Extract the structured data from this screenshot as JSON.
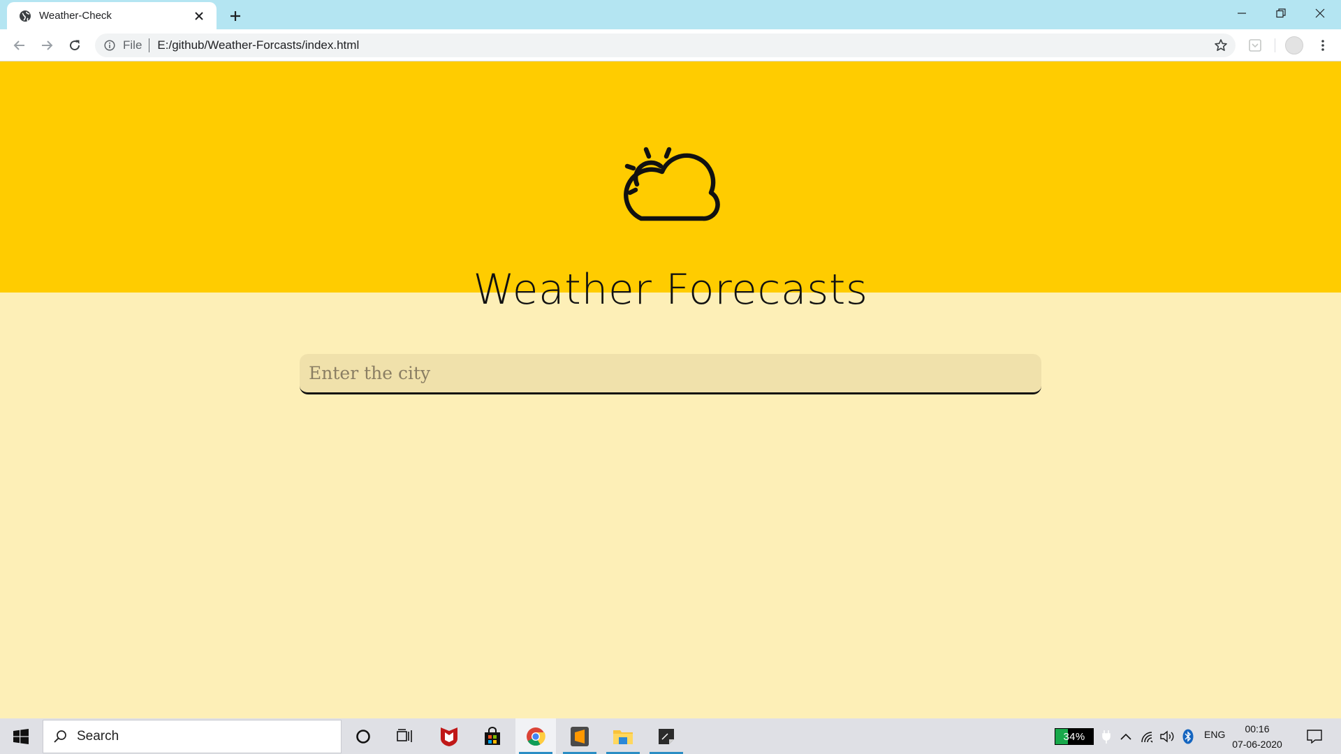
{
  "browser": {
    "tab_title": "Weather-Check",
    "address_scheme": "File",
    "address_url": "E:/github/Weather-Forcasts/index.html"
  },
  "page": {
    "title": "Weather Forecasts",
    "search_placeholder": "Enter the city",
    "colors": {
      "hero": "#ffcc00",
      "background": "#fdefb7",
      "input": "#f0e1ab"
    }
  },
  "taskbar": {
    "search_label": "Search",
    "battery_percent": 34,
    "battery_label": "34%",
    "language": "ENG",
    "time": "00:16",
    "date": "07-06-2020",
    "apps": [
      "task-view",
      "mcafee",
      "microsoft-store",
      "chrome",
      "sublime-text",
      "file-explorer",
      "sticky-notes"
    ]
  }
}
